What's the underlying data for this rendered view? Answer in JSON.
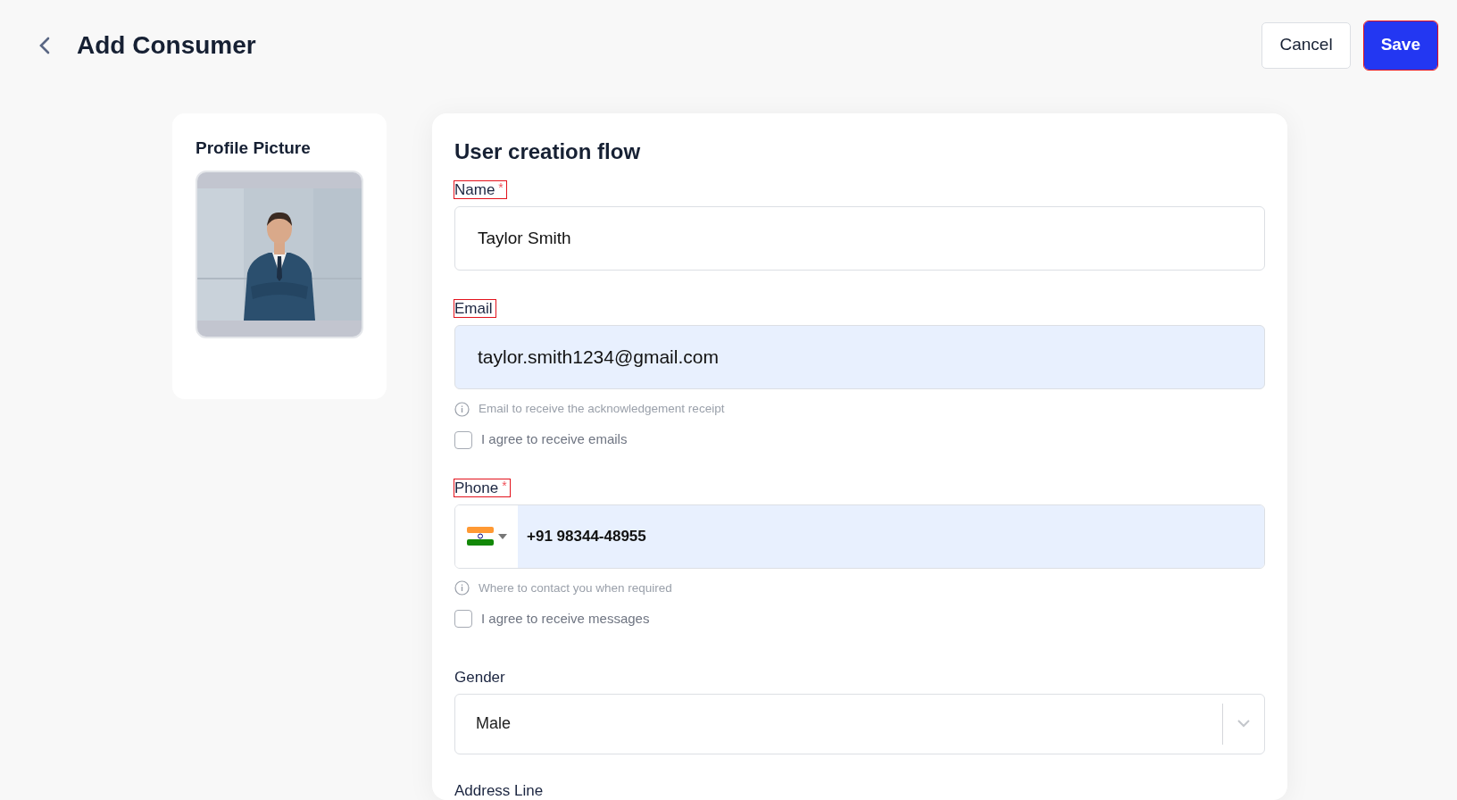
{
  "header": {
    "title": "Add Consumer",
    "buttons": [
      {
        "label": "Cancel",
        "kind": "secondary",
        "highlighted": false
      },
      {
        "label": "Save",
        "kind": "primary",
        "highlighted": true
      }
    ]
  },
  "profile": {
    "title": "Profile Picture"
  },
  "form": {
    "title": "User creation flow",
    "fields": [
      {
        "kind": "text",
        "label": "Name",
        "required_mark": "*",
        "highlighted": true,
        "value": "Taylor Smith",
        "autofilled": false
      },
      {
        "kind": "text",
        "label": "Email",
        "highlighted": true,
        "value": "taylor.smith1234@gmail.com",
        "autofilled": true,
        "hint": "Email to receive the acknowledgement receipt",
        "consent": {
          "label": "I agree to receive emails",
          "checked": false
        }
      },
      {
        "kind": "phone",
        "label": "Phone",
        "required_mark": "*",
        "highlighted": true,
        "value": "+91 98344-48955",
        "autofilled": true,
        "hint": "Where to contact you when required",
        "consent": {
          "label": "I agree to receive messages",
          "checked": false
        }
      },
      {
        "kind": "select",
        "label": "Gender",
        "highlighted": false,
        "value": "Male",
        "autofilled": false
      },
      {
        "kind": "label_only",
        "label": "Address Line",
        "highlighted": false
      }
    ]
  }
}
